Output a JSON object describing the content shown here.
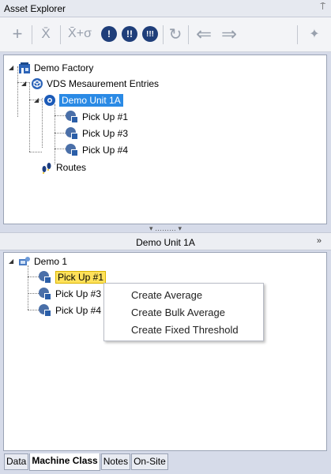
{
  "panel": {
    "title": "Asset Explorer",
    "pin_glyph": "⍑"
  },
  "toolbar": {
    "buttons": [
      {
        "icon": "add-icon",
        "glyph": "+"
      },
      {
        "icon": "mean-icon",
        "glyph": "X̄"
      },
      {
        "icon": "mean-plus-sigma-icon",
        "glyph": "X̄+σ"
      },
      {
        "icon": "alarm-1-icon",
        "glyph": "!"
      },
      {
        "icon": "alarm-2-icon",
        "glyph": "!!"
      },
      {
        "icon": "alarm-3-icon",
        "glyph": "!!!"
      },
      {
        "icon": "refresh-icon",
        "glyph": "↻"
      },
      {
        "icon": "back-arrow-icon",
        "glyph": "⇐"
      },
      {
        "icon": "forward-arrow-icon",
        "glyph": "⇒"
      },
      {
        "icon": "broom-icon",
        "glyph": "✦"
      }
    ]
  },
  "tree": {
    "root": "Demo Factory",
    "group": "VDS Mesaurement Entries",
    "unit": "Demo Unit 1A",
    "pickups": [
      "Pick Up #1",
      "Pick Up #3",
      "Pick Up #4"
    ],
    "routes": "Routes"
  },
  "splitter_glyph": "▾ ……… ▾",
  "machine_panel": {
    "title": "Demo Unit 1A",
    "chevron": "»",
    "root": "Demo 1",
    "pickups": [
      "Pick Up #1",
      "Pick Up #3",
      "Pick Up #4"
    ]
  },
  "context_menu": {
    "items": [
      "Create Average",
      "Create Bulk Average",
      "Create Fixed Threshold"
    ]
  },
  "tabs": [
    {
      "label": "Data",
      "active": false
    },
    {
      "label": "Machine Class",
      "active": true
    },
    {
      "label": "Notes",
      "active": false
    },
    {
      "label": "On-Site",
      "active": false
    }
  ],
  "colors": {
    "selection": "#2a8ae5",
    "highlight": "#ffe15a",
    "toolbar_icon_dark": "#1f3e7a"
  }
}
